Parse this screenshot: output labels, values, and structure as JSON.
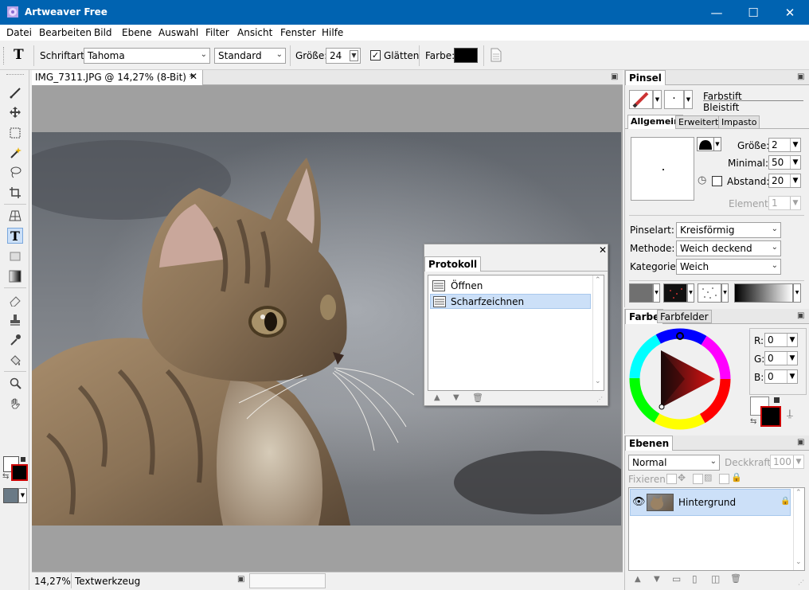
{
  "window": {
    "title": "Artweaver Free",
    "minimize": "—",
    "maximize": "☐",
    "close": "✕"
  },
  "menu": [
    "Datei",
    "Bearbeiten",
    "Bild",
    "Ebene",
    "Auswahl",
    "Filter",
    "Ansicht",
    "Fenster",
    "Hilfe"
  ],
  "options": {
    "font_label": "Schriftart:",
    "font_value": "Tahoma",
    "style_value": "Standard",
    "size_label": "Größe:",
    "size_value": "24",
    "smooth_label": "Glätten",
    "smooth_checked": true,
    "color_label": "Farbe:",
    "color_value": "#000000"
  },
  "document": {
    "tab_title": "IMG_7311.JPG @ 14,27% (8-Bit) *",
    "close": "✕"
  },
  "status": {
    "zoom": "14,27%",
    "tool": "Textwerkzeug"
  },
  "protokoll": {
    "title": "Protokoll",
    "items": [
      "Öffnen",
      "Scharfzeichnen"
    ],
    "selected_index": 1
  },
  "pinsel": {
    "title": "Pinsel",
    "brush_name": "Farbstift",
    "brush_variant": "Bleistift",
    "tabs": [
      "Allgemein",
      "Erweitert",
      "Impasto"
    ],
    "size_label": "Größe:",
    "size_value": "2",
    "min_label": "Minimal:",
    "min_value": "50",
    "spacing_label": "Abstand:",
    "spacing_value": "20",
    "element_label": "Element:",
    "element_value": "1",
    "type_label": "Pinselart:",
    "type_value": "Kreisförmig",
    "method_label": "Methode:",
    "method_value": "Weich deckend",
    "category_label": "Kategorie:",
    "category_value": "Weich"
  },
  "farbe": {
    "tabs": [
      "Farbe",
      "Farbfelder"
    ],
    "r_label": "R:",
    "r_value": "0",
    "g_label": "G:",
    "g_value": "0",
    "b_label": "B:",
    "b_value": "0",
    "foreground": "#000000",
    "background": "#ffffff"
  },
  "ebenen": {
    "title": "Ebenen",
    "blend_mode": "Normal",
    "opacity_label": "Deckkraft:",
    "opacity_value": "100",
    "fix_label": "Fixieren:",
    "layers": [
      "Hintergrund"
    ]
  },
  "colors": {
    "accent": "#0063b1",
    "selection": "#cce0f8"
  }
}
